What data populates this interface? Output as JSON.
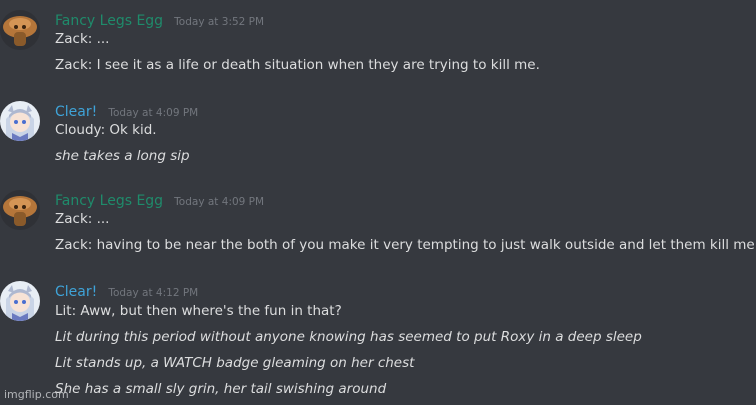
{
  "colors": {
    "background": "#36393f",
    "fancy_legs_egg": "#1f8b6b",
    "clear": "#3fa3d8",
    "timestamp": "#72767d",
    "text": "#dcddde"
  },
  "messages": [
    {
      "username": "Fancy Legs Egg",
      "timestamp": "Today at 3:52 PM",
      "avatar_icon": "mushroom-avatar-icon",
      "lines": [
        {
          "text": "Zack: ...",
          "italic": false
        },
        {
          "text": "Zack: I see it as a life or death situation when they are trying to kill me.",
          "italic": false
        }
      ]
    },
    {
      "username": "Clear!",
      "timestamp": "Today at 4:09 PM",
      "avatar_icon": "anime-character-avatar-icon",
      "lines": [
        {
          "text": "Cloudy: Ok kid.",
          "italic": false
        },
        {
          "text": "she takes a long sip",
          "italic": true
        }
      ]
    },
    {
      "username": "Fancy Legs Egg",
      "timestamp": "Today at 4:09 PM",
      "avatar_icon": "mushroom-avatar-icon",
      "lines": [
        {
          "text": "Zack: ...",
          "italic": false
        },
        {
          "text": "Zack: having to be near the both of you make it very tempting to just walk outside and let them kill me.",
          "italic": false
        }
      ]
    },
    {
      "username": "Clear!",
      "timestamp": "Today at 4:12 PM",
      "avatar_icon": "anime-character-avatar-icon",
      "lines": [
        {
          "text": "Lit: Aww, but then where's the fun in that?",
          "italic": false
        },
        {
          "text": "Lit during this period without anyone knowing has seemed to put Roxy in a deep sleep",
          "italic": true
        },
        {
          "text": "Lit stands up, a WATCH badge gleaming on her chest",
          "italic": true
        },
        {
          "text": "She has a small sly grin, her tail swishing around",
          "italic": true
        }
      ]
    }
  ],
  "watermark": "imgflip.com"
}
